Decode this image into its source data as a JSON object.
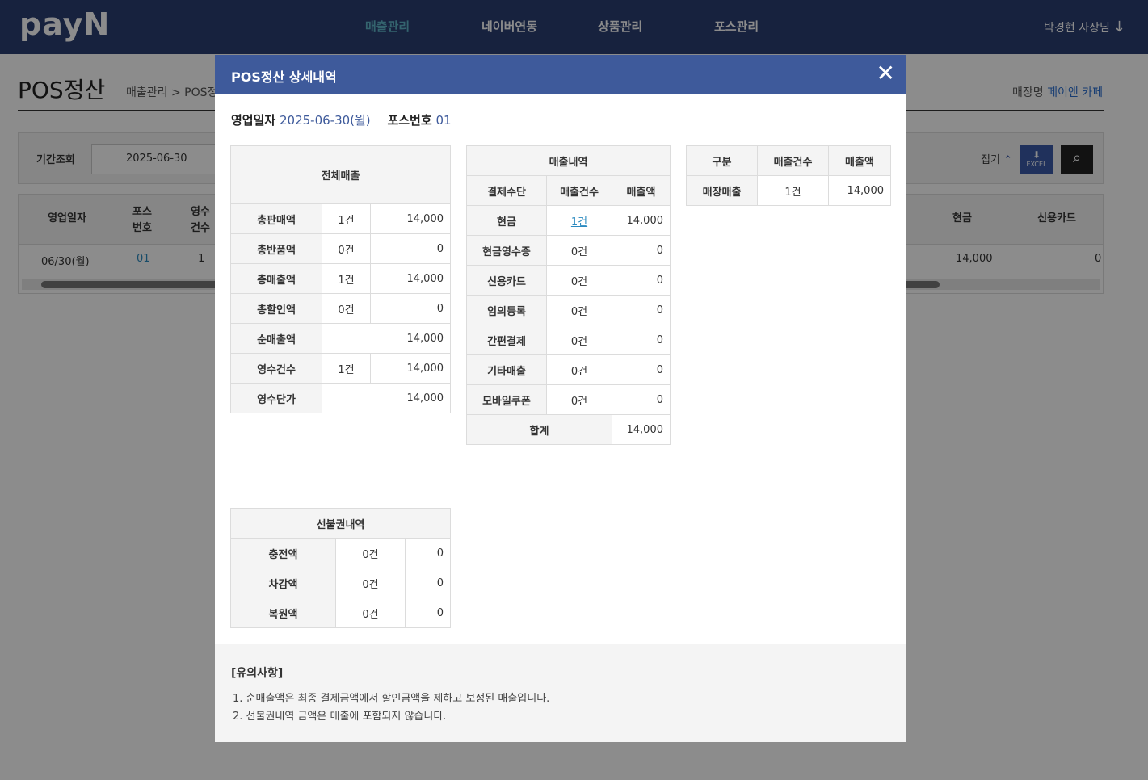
{
  "header": {
    "logo": "payN",
    "nav": [
      "매출관리",
      "네이버연동",
      "상품관리",
      "포스관리"
    ],
    "user": "박경현 사장님"
  },
  "page": {
    "title": "POS정산",
    "breadcrumb": "매출관리 > POS정",
    "store_label": "매장명",
    "store_name": "페이앤 카페"
  },
  "filter": {
    "label": "기간조회",
    "date": "2025-06-30",
    "fold": "접기",
    "excel": "EXCEL"
  },
  "grid": {
    "headers": [
      "영업일자",
      "포스\n번호",
      "영수\n건수",
      "현금",
      "신용카드"
    ],
    "row": [
      "06/30(월)",
      "01",
      "1",
      "14,000",
      "0"
    ]
  },
  "modal": {
    "title": "POS정산 상세내역",
    "business_date_label": "영업일자",
    "business_date": "2025-06-30(월)",
    "pos_label": "포스번호",
    "pos_no": "01",
    "total": {
      "title": "전체매출",
      "rows": [
        {
          "label": "총판매액",
          "count": "1건",
          "amount": "14,000"
        },
        {
          "label": "총반품액",
          "count": "0건",
          "amount": "0"
        },
        {
          "label": "총매출액",
          "count": "1건",
          "amount": "14,000"
        },
        {
          "label": "총할인액",
          "count": "0건",
          "amount": "0"
        },
        {
          "label": "순매출액",
          "count": "",
          "amount": "14,000"
        },
        {
          "label": "영수건수",
          "count": "1건",
          "amount": "14,000"
        },
        {
          "label": "영수단가",
          "count": "",
          "amount": "14,000"
        }
      ]
    },
    "sales": {
      "title": "매출내역",
      "headers": [
        "결제수단",
        "매출건수",
        "매출액"
      ],
      "rows": [
        {
          "label": "현금",
          "count": "1건",
          "amount": "14,000"
        },
        {
          "label": "현금영수증",
          "count": "0건",
          "amount": "0"
        },
        {
          "label": "신용카드",
          "count": "0건",
          "amount": "0"
        },
        {
          "label": "임의등록",
          "count": "0건",
          "amount": "0"
        },
        {
          "label": "간편결제",
          "count": "0건",
          "amount": "0"
        },
        {
          "label": "기타매출",
          "count": "0건",
          "amount": "0"
        },
        {
          "label": "모바일쿠폰",
          "count": "0건",
          "amount": "0"
        }
      ],
      "total_label": "합계",
      "total_amount": "14,000"
    },
    "channel": {
      "headers": [
        "구분",
        "매출건수",
        "매출액"
      ],
      "row": {
        "label": "매장매출",
        "count": "1건",
        "amount": "14,000"
      }
    },
    "prepaid": {
      "title": "선불권내역",
      "rows": [
        {
          "label": "충전액",
          "count": "0건",
          "amount": "0"
        },
        {
          "label": "차감액",
          "count": "0건",
          "amount": "0"
        },
        {
          "label": "복원액",
          "count": "0건",
          "amount": "0"
        }
      ]
    },
    "notes": {
      "title": "[유의사항]",
      "items": [
        "1. 순매출액은 최종 결제금액에서 할인금액을 제하고 보정된 매출입니다.",
        "2. 선불권내역 금액은 매출에 포함되지 않습니다."
      ]
    }
  }
}
